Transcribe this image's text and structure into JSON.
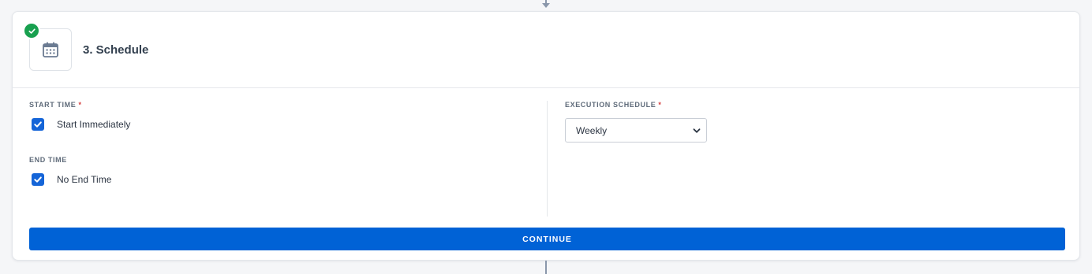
{
  "step": {
    "title": "3. Schedule",
    "completed": true,
    "icon": "calendar-icon"
  },
  "start_time": {
    "label": "START TIME",
    "required_marker": "*",
    "checkbox_label": "Start Immediately",
    "checked": true
  },
  "end_time": {
    "label": "END TIME",
    "checkbox_label": "No End Time",
    "checked": true
  },
  "execution_schedule": {
    "label": "EXECUTION SCHEDULE",
    "required_marker": "*",
    "selected": "Weekly"
  },
  "continue_label": "CONTINUE",
  "colors": {
    "primary": "#0062d6",
    "success": "#18a04f",
    "required": "#d43c3c"
  }
}
